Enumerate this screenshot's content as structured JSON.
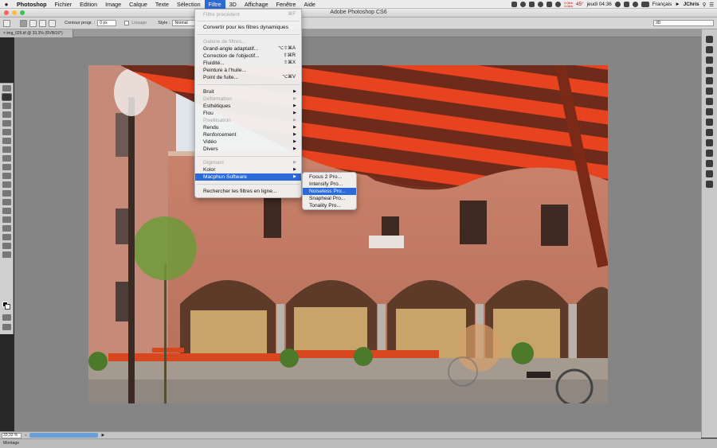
{
  "menubar": {
    "apple": "",
    "items": [
      "Photoshop",
      "Fichier",
      "Edition",
      "Image",
      "Calque",
      "Texte",
      "Sélection",
      "Filtre",
      "3D",
      "Affichage",
      "Fenêtre",
      "Aide"
    ],
    "active_index": 7,
    "status": {
      "clock": "jeudi 04:36",
      "language": "Français",
      "user": "JChris",
      "net_up": "0.0k/s",
      "net_down": "0.0k/s",
      "temp": "45°"
    }
  },
  "window": {
    "title": "Adobe Photoshop CS6"
  },
  "options": {
    "feather_label": "Contour progr. :",
    "feather_value": "0 px",
    "antialias_label": "Lissage",
    "style_label": "Style :",
    "style_value": "Normal",
    "workspace": "3D"
  },
  "document": {
    "tab_label": "img_026.tif @ 33,3% (RVB/16*)",
    "zoom": "33,33 %",
    "close_glyph": "×"
  },
  "timeline": {
    "label": "Montage"
  },
  "filter_menu": {
    "items": [
      {
        "label": "Filtre précédent",
        "shortcut": "⌘F",
        "disabled": true
      },
      {
        "label": "Convertir pour les filtres dynamiques"
      },
      {
        "label": "Galerie de filtres...",
        "disabled": true
      },
      {
        "label": "Grand-angle adaptatif...",
        "shortcut": "⌥⇧⌘A"
      },
      {
        "label": "Correction de l'objectif...",
        "shortcut": "⇧⌘R"
      },
      {
        "label": "Fluidité...",
        "shortcut": "⇧⌘X"
      },
      {
        "label": "Peinture à l'huile..."
      },
      {
        "label": "Point de fuite...",
        "shortcut": "⌥⌘V"
      },
      {
        "label": "Bruit",
        "submenu": true
      },
      {
        "label": "Déformation",
        "submenu": true,
        "disabled": true
      },
      {
        "label": "Esthétiques",
        "submenu": true
      },
      {
        "label": "Flou",
        "submenu": true
      },
      {
        "label": "Pixellisation",
        "submenu": true,
        "disabled": true
      },
      {
        "label": "Rendu",
        "submenu": true
      },
      {
        "label": "Renforcement",
        "submenu": true
      },
      {
        "label": "Vidéo",
        "submenu": true
      },
      {
        "label": "Divers",
        "submenu": true
      },
      {
        "label": "Digimarc",
        "submenu": true,
        "disabled": true
      },
      {
        "label": "Kolor",
        "submenu": true
      },
      {
        "label": "Macphun Software",
        "submenu": true,
        "highlighted": true
      },
      {
        "label": "Rechercher les filtres en ligne..."
      }
    ]
  },
  "submenu": {
    "items": [
      {
        "label": "Focus 2 Pro..."
      },
      {
        "label": "Intensify Pro..."
      },
      {
        "label": "Noiseless Pro...",
        "highlighted": true
      },
      {
        "label": "Snapheal Pro..."
      },
      {
        "label": "Tonality Pro..."
      }
    ]
  },
  "colors": {
    "accent": "#2a6ad9",
    "canvas": "#858585",
    "umbrella_red": "#e23d1c"
  }
}
